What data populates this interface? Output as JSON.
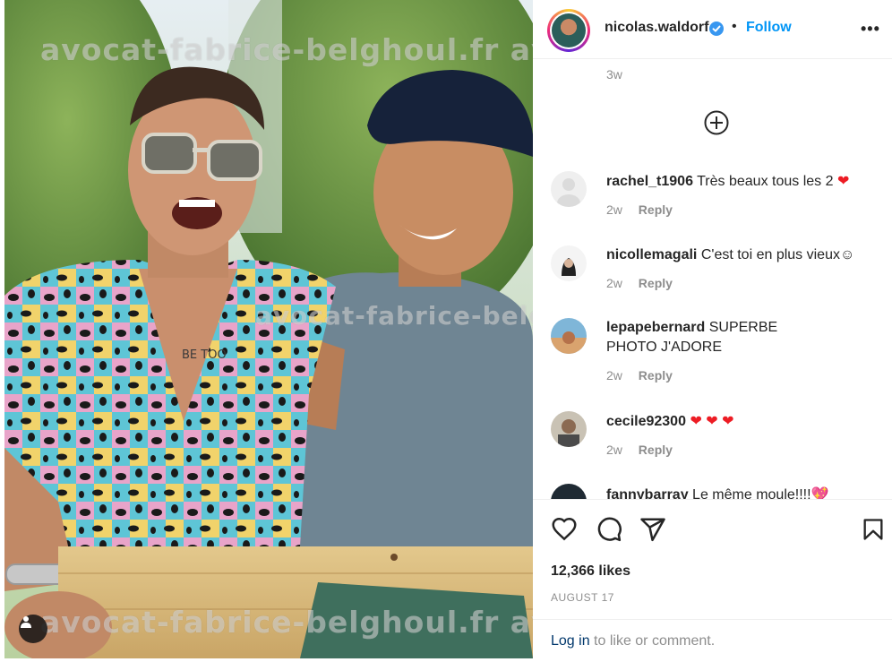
{
  "post": {
    "username": "nicolas.waldorf",
    "separator": "•",
    "follow_label": "Follow",
    "more_label": "•••",
    "posted_ago": "3w",
    "likes": "12,366 likes",
    "date": "AUGUST 17"
  },
  "watermark": {
    "text": "avocat-fabrice-belghoul.fr avocat-fabrice-belghoul.fr",
    "center_text": "avocat-fabrice-belghoul.fr"
  },
  "photo": {
    "shirt_tattoo_text": "BE TOO"
  },
  "comments": [
    {
      "user": "rachel_t1906",
      "text": "Très beaux tous les 2",
      "emoji": "❤",
      "age": "2w",
      "reply": "Reply"
    },
    {
      "user": "nicollemagali",
      "text": "C'est toi en plus vieux",
      "emoji": "☺",
      "age": "2w",
      "reply": "Reply"
    },
    {
      "user": "lepapebernard",
      "text": "SUPERBE PHOTO J'ADORE",
      "emoji": "",
      "age": "2w",
      "reply": "Reply"
    },
    {
      "user": "cecile92300",
      "text": "",
      "emoji": "❤ ❤ ❤",
      "age": "2w",
      "reply": "Reply"
    },
    {
      "user": "fannybarray",
      "text": "Le même moule!!!!",
      "emoji": "💖",
      "age": "",
      "reply": ""
    }
  ],
  "footer": {
    "login_link": "Log in",
    "login_rest": " to like or comment."
  },
  "colors": {
    "accent": "#0095f6",
    "verified": "#3897f0",
    "heart": "#ed1c24",
    "muted": "#8e8e8e"
  },
  "icons": [
    "user-tag-icon",
    "verified-badge-icon",
    "more-options-icon",
    "add-circle-icon",
    "like-heart-icon",
    "comment-icon",
    "share-icon",
    "save-bookmark-icon"
  ]
}
